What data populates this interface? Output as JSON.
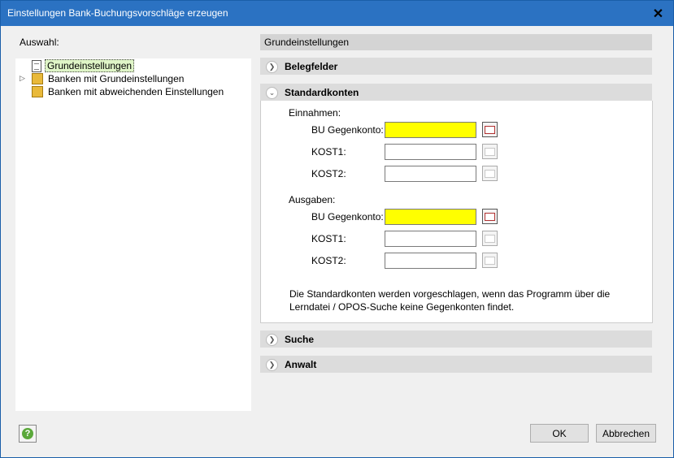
{
  "window": {
    "title": "Einstellungen Bank-Buchungsvorschläge erzeugen"
  },
  "left": {
    "label": "Auswahl:",
    "tree": [
      {
        "label": "Grundeinstellungen",
        "icon": "document-icon",
        "selected": true
      },
      {
        "label": "Banken mit Grundeinstellungen",
        "icon": "bank-folder-icon",
        "expandable": true
      },
      {
        "label": "Banken mit abweichenden Einstellungen",
        "icon": "bank-folder-icon"
      }
    ]
  },
  "right": {
    "header": "Grundeinstellungen",
    "sections": {
      "belegfelder": "Belegfelder",
      "standardkonten": "Standardkonten",
      "suche": "Suche",
      "anwalt": "Anwalt"
    },
    "einnahmen": {
      "group_label": "Einnahmen:",
      "bu_label": "BU Gegenkonto:",
      "kost1_label": "KOST1:",
      "kost2_label": "KOST2:",
      "bu_value": "",
      "kost1_value": "",
      "kost2_value": ""
    },
    "ausgaben": {
      "group_label": "Ausgaben:",
      "bu_label": "BU Gegenkonto:",
      "kost1_label": "KOST1:",
      "kost2_label": "KOST2:",
      "bu_value": "",
      "kost1_value": "",
      "kost2_value": ""
    },
    "note": "Die Standardkonten werden vorgeschlagen, wenn das Programm über die Lerndatei / OPOS-Suche keine Gegenkonten findet."
  },
  "footer": {
    "ok": "OK",
    "cancel": "Abbrechen"
  },
  "colors": {
    "titlebar": "#2b72c2",
    "highlight": "#ffff00"
  }
}
